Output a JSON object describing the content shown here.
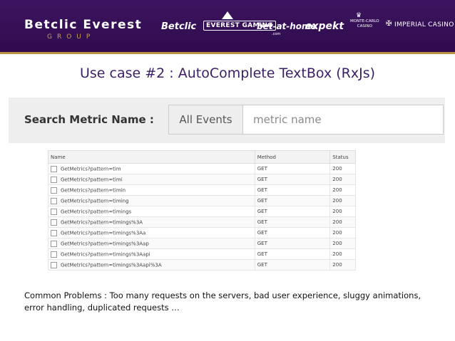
{
  "header": {
    "brand_title": "Betclic Everest",
    "brand_subtitle": "GROUP",
    "partners": {
      "betclic": "Betclic",
      "everest": "EVEREST GAMING",
      "bet_at_home": "bet-at-home",
      "bet_at_home_sub": ".com",
      "expekt": "expekt",
      "monte_carlo_line1": "MONTE-CARLO",
      "monte_carlo_line2": "CASINO",
      "imperial": "IMPERIAL CASINO"
    }
  },
  "slide": {
    "title": "Use case #2 : AutoComplete TextBox (RxJs)"
  },
  "search": {
    "label": "Search Metric Name :",
    "addon": "All Events",
    "placeholder": "metric name",
    "value": ""
  },
  "network": {
    "columns": [
      "Name",
      "Method",
      "Status"
    ],
    "rows": [
      {
        "name": "GetMetrics?pattern=tim",
        "method": "GET",
        "status": "200"
      },
      {
        "name": "GetMetrics?pattern=timi",
        "method": "GET",
        "status": "200"
      },
      {
        "name": "GetMetrics?pattern=timin",
        "method": "GET",
        "status": "200"
      },
      {
        "name": "GetMetrics?pattern=timing",
        "method": "GET",
        "status": "200"
      },
      {
        "name": "GetMetrics?pattern=timings",
        "method": "GET",
        "status": "200"
      },
      {
        "name": "GetMetrics?pattern=timings%3A",
        "method": "GET",
        "status": "200"
      },
      {
        "name": "GetMetrics?pattern=timings%3Aa",
        "method": "GET",
        "status": "200"
      },
      {
        "name": "GetMetrics?pattern=timings%3Aap",
        "method": "GET",
        "status": "200"
      },
      {
        "name": "GetMetrics?pattern=timings%3Aapi",
        "method": "GET",
        "status": "200"
      },
      {
        "name": "GetMetrics?pattern=timings%3Aapi%3A",
        "method": "GET",
        "status": "200"
      }
    ]
  },
  "footer": {
    "problems": "Common Problems : Too many requests on the servers, bad user experience, sluggy animations, error handling, duplicated requests …"
  },
  "colors": {
    "banner": "#2e0c4d",
    "gold": "#b88f3e",
    "title": "#3b1f66"
  }
}
